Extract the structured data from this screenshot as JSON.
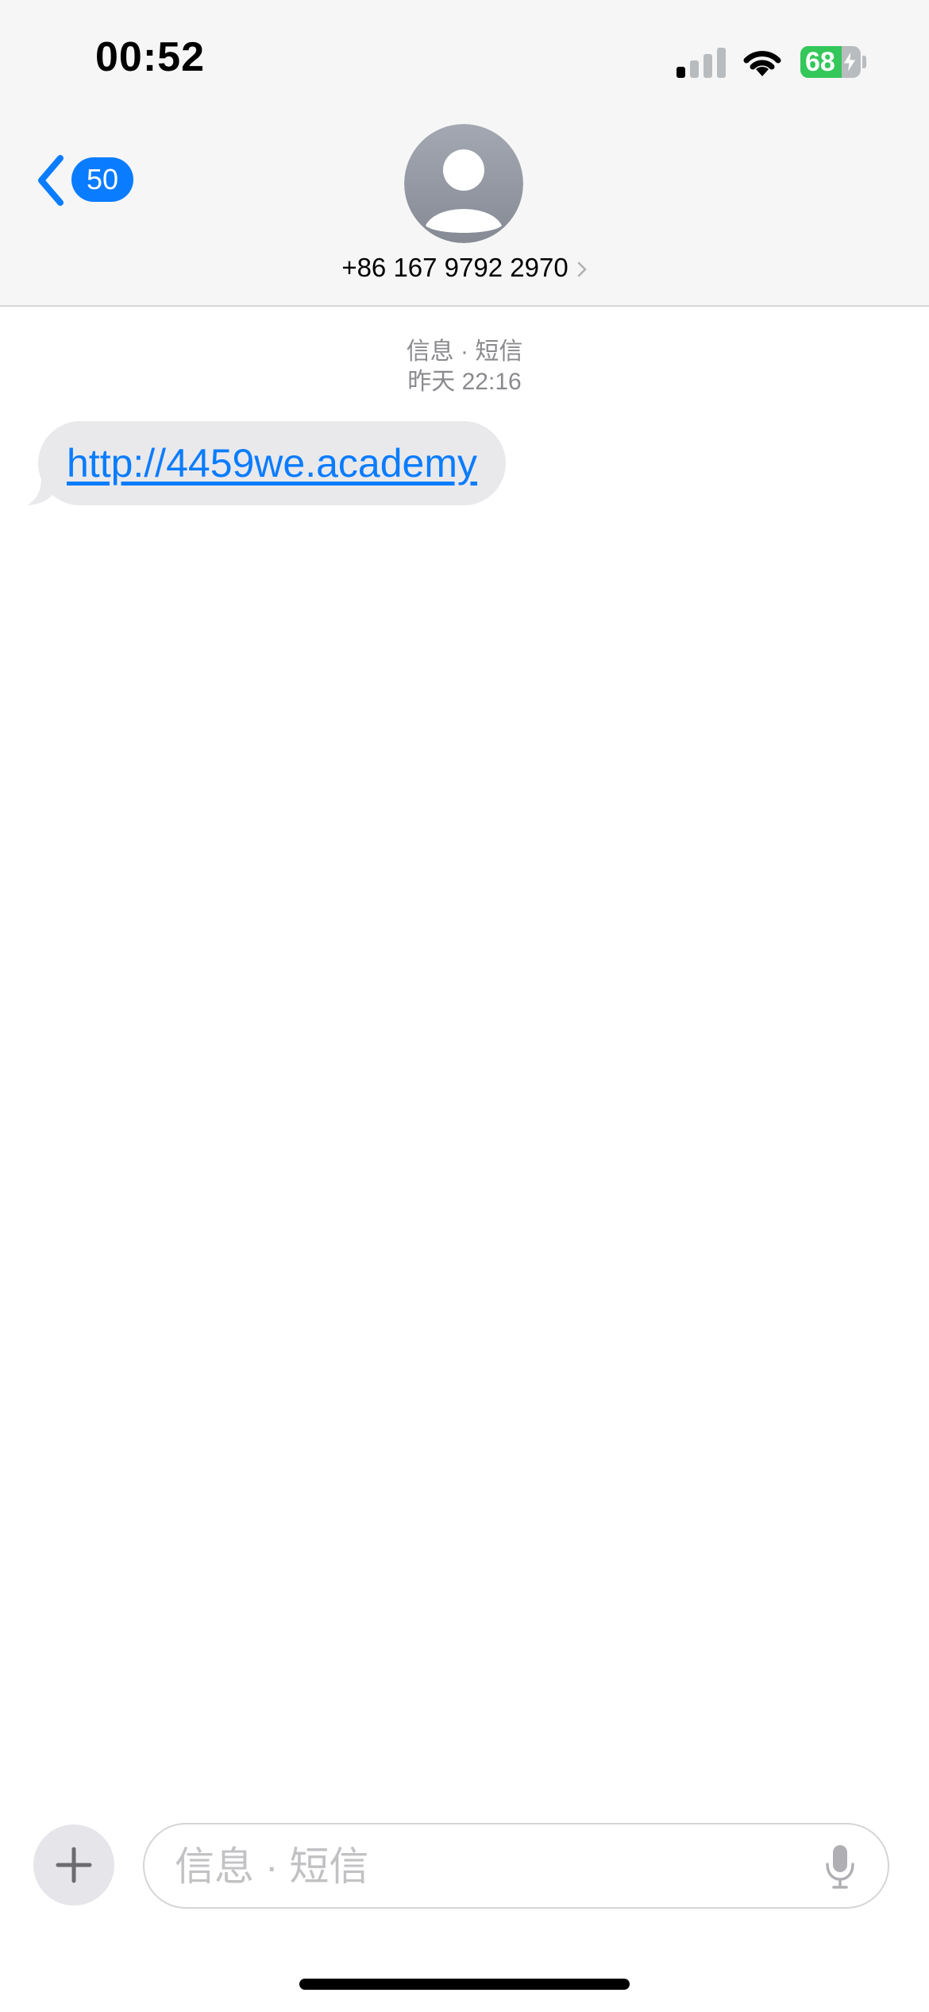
{
  "status_bar": {
    "time": "00:52",
    "signal_bars_active": 1,
    "signal_bars_total": 4,
    "battery_level": "68",
    "battery_charging": true,
    "battery_color": "#34c759"
  },
  "header": {
    "back_badge": "50",
    "contact_name": "+86 167 9792 2970",
    "accent_color": "#0a7cff"
  },
  "conversation": {
    "service_label": "信息 · 短信",
    "timestamp": "昨天 22:16",
    "messages": [
      {
        "text": "http://4459we.academy",
        "direction": "incoming",
        "is_link": true
      }
    ]
  },
  "compose": {
    "placeholder": "信息 · 短信"
  },
  "icons": [
    "back-chevron-icon",
    "contact-avatar-icon",
    "chevron-right-icon",
    "plus-icon",
    "microphone-icon",
    "wifi-icon",
    "signal-icon",
    "battery-icon",
    "charging-bolt-icon"
  ]
}
